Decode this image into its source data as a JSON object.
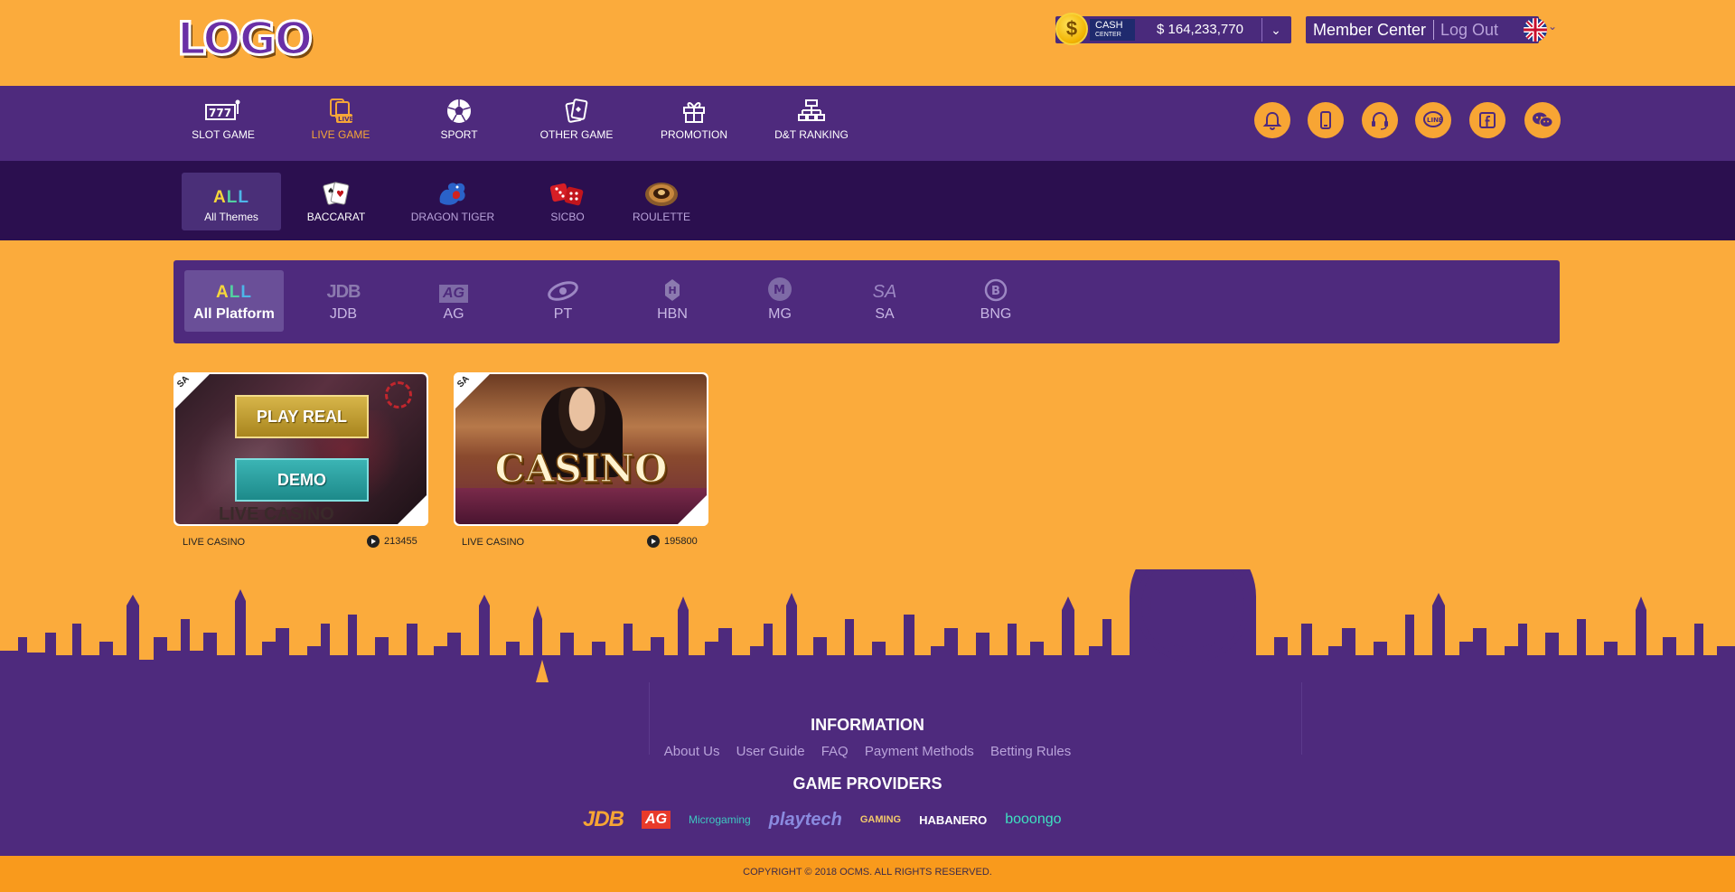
{
  "header": {
    "logo_text": "LOGO",
    "cash": {
      "label": "CASH",
      "sublabel": "CENTER",
      "amount": "$ 164,233,770",
      "coin_symbol": "$"
    },
    "member_center": "Member Center",
    "logout": "Log Out",
    "language_icon": "uk-flag-icon"
  },
  "main_nav": [
    {
      "label": "SLOT GAME",
      "icon": "slot-machine-icon",
      "active": false
    },
    {
      "label": "LIVE GAME",
      "icon": "live-cards-icon",
      "active": true
    },
    {
      "label": "SPORT",
      "icon": "soccer-ball-icon",
      "active": false
    },
    {
      "label": "OTHER GAME",
      "icon": "cards-icon",
      "active": false
    },
    {
      "label": "PROMOTION",
      "icon": "gift-icon",
      "active": false
    },
    {
      "label": "D&T RANKING",
      "icon": "ranking-icon",
      "active": false
    }
  ],
  "quick_icons": [
    "bell-icon",
    "mobile-icon",
    "headset-icon",
    "line-icon",
    "facebook-icon",
    "wechat-icon"
  ],
  "themes": [
    {
      "label": "All Themes",
      "icon_text": "ALL",
      "active": true
    },
    {
      "label": "BACCARAT",
      "icon": "playing-cards-icon",
      "active": false
    },
    {
      "label": "DRAGON TIGER",
      "icon": "dragon-icon",
      "active": false
    },
    {
      "label": "SICBO",
      "icon": "dice-icon",
      "active": false
    },
    {
      "label": "ROULETTE",
      "icon": "roulette-icon",
      "active": false
    }
  ],
  "platforms": [
    {
      "label": "All Platform",
      "icon_text": "ALL",
      "active": true
    },
    {
      "label": "JDB",
      "icon_text": "JDB"
    },
    {
      "label": "AG",
      "icon_text": "AG"
    },
    {
      "label": "PT",
      "icon_text": "PT"
    },
    {
      "label": "HBN",
      "icon_text": "H"
    },
    {
      "label": "MG",
      "icon_text": "M"
    },
    {
      "label": "SA",
      "icon_text": "SA"
    },
    {
      "label": "BNG",
      "icon_text": "B"
    }
  ],
  "games": [
    {
      "badge": "SA",
      "name": "LIVE CASINO",
      "plays": "213455",
      "play_real": "PLAY REAL",
      "demo": "DEMO",
      "banner_text": "LIVE CASINO"
    },
    {
      "badge": "SA",
      "name": "LIVE CASINO",
      "plays": "195800",
      "banner_text": "CASINO"
    }
  ],
  "footer": {
    "info_title": "INFORMATION",
    "links": [
      "About Us",
      "User Guide",
      "FAQ",
      "Payment Methods",
      "Betting Rules"
    ],
    "providers_title": "GAME PROVIDERS",
    "providers": [
      "JDB",
      "AG",
      "Microgaming",
      "playtech",
      "GAMING",
      "HABANERO",
      "booongo"
    ],
    "copyright": "COPYRIGHT © 2018 OCMS. ALL RIGHTS RESERVED."
  },
  "colors": {
    "background": "#fbab3c",
    "purple": "#4e2a7d",
    "dark_purple": "#2b0f4f",
    "accent": "#f7a534"
  }
}
